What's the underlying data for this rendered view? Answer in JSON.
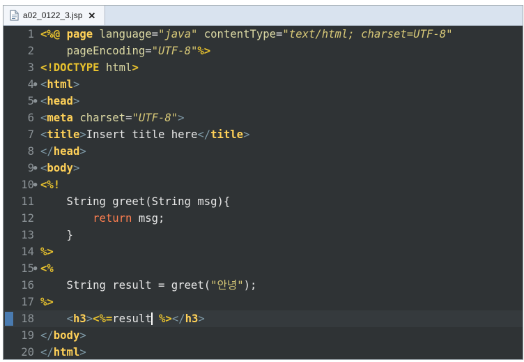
{
  "tab": {
    "filename": "a02_0122_3.jsp",
    "close_glyph": "✕"
  },
  "lines": [
    {
      "n": "1",
      "fold": "",
      "tokens": [
        [
          "jsp",
          "<%@ "
        ],
        [
          "tn",
          "page "
        ],
        [
          "att",
          "language"
        ],
        [
          "plain",
          "="
        ],
        [
          "val",
          "\"java\""
        ],
        [
          "plain",
          " "
        ],
        [
          "att",
          "contentType"
        ],
        [
          "plain",
          "="
        ],
        [
          "val",
          "\"text/html; charset=UTF-8\""
        ]
      ]
    },
    {
      "n": "2",
      "fold": "",
      "tokens": [
        [
          "plain",
          "    "
        ],
        [
          "att",
          "pageEncoding"
        ],
        [
          "plain",
          "="
        ],
        [
          "val",
          "\"UTF-8\""
        ],
        [
          "jsp",
          "%>"
        ]
      ]
    },
    {
      "n": "3",
      "fold": "",
      "tokens": [
        [
          "jsp",
          "<!DOCTYPE "
        ],
        [
          "att",
          "html"
        ],
        [
          "jsp",
          ">"
        ]
      ]
    },
    {
      "n": "4",
      "fold": "●",
      "tokens": [
        [
          "tag",
          "<"
        ],
        [
          "tn",
          "html"
        ],
        [
          "tag",
          ">"
        ]
      ]
    },
    {
      "n": "5",
      "fold": "●",
      "tokens": [
        [
          "tag",
          "<"
        ],
        [
          "tn",
          "head"
        ],
        [
          "tag",
          ">"
        ]
      ]
    },
    {
      "n": "6",
      "fold": "",
      "tokens": [
        [
          "tag",
          "<"
        ],
        [
          "tn",
          "meta "
        ],
        [
          "att",
          "charset"
        ],
        [
          "plain",
          "="
        ],
        [
          "val",
          "\"UTF-8\""
        ],
        [
          "tag",
          ">"
        ]
      ]
    },
    {
      "n": "7",
      "fold": "",
      "tokens": [
        [
          "tag",
          "<"
        ],
        [
          "tn",
          "title"
        ],
        [
          "tag",
          ">"
        ],
        [
          "plain",
          "Insert title here"
        ],
        [
          "tag",
          "</"
        ],
        [
          "tn",
          "title"
        ],
        [
          "tag",
          ">"
        ]
      ]
    },
    {
      "n": "8",
      "fold": "",
      "tokens": [
        [
          "tag",
          "</"
        ],
        [
          "tn",
          "head"
        ],
        [
          "tag",
          ">"
        ]
      ]
    },
    {
      "n": "9",
      "fold": "●",
      "tokens": [
        [
          "tag",
          "<"
        ],
        [
          "tn",
          "body"
        ],
        [
          "tag",
          ">"
        ]
      ]
    },
    {
      "n": "10",
      "fold": "●",
      "tokens": [
        [
          "jsp",
          "<%!"
        ]
      ]
    },
    {
      "n": "11",
      "fold": "",
      "tokens": [
        [
          "plain",
          "    String greet(String msg){"
        ]
      ]
    },
    {
      "n": "12",
      "fold": "",
      "tokens": [
        [
          "plain",
          "        "
        ],
        [
          "kw",
          "return"
        ],
        [
          "plain",
          " msg;"
        ]
      ]
    },
    {
      "n": "13",
      "fold": "",
      "tokens": [
        [
          "plain",
          "    }"
        ]
      ]
    },
    {
      "n": "14",
      "fold": "",
      "tokens": [
        [
          "jsp",
          "%>"
        ]
      ]
    },
    {
      "n": "15",
      "fold": "●",
      "tokens": [
        [
          "jsp",
          "<%"
        ]
      ]
    },
    {
      "n": "16",
      "fold": "",
      "tokens": [
        [
          "plain",
          "    String result = greet("
        ],
        [
          "str",
          "\"안녕\""
        ],
        [
          "plain",
          ");"
        ]
      ]
    },
    {
      "n": "17",
      "fold": "",
      "tokens": [
        [
          "jsp",
          "%>"
        ]
      ]
    },
    {
      "n": "18",
      "fold": "",
      "current": true,
      "tokens": [
        [
          "plain",
          "    "
        ],
        [
          "tag",
          "<"
        ],
        [
          "tn",
          "h3"
        ],
        [
          "tag",
          ">"
        ],
        [
          "jsp",
          "<%="
        ],
        [
          "plain",
          "result"
        ],
        [
          "caret",
          ""
        ],
        [
          "plain",
          " "
        ],
        [
          "jsp",
          "%>"
        ],
        [
          "tag",
          "</"
        ],
        [
          "tn",
          "h3"
        ],
        [
          "tag",
          ">"
        ]
      ]
    },
    {
      "n": "19",
      "fold": "",
      "tokens": [
        [
          "tag",
          "</"
        ],
        [
          "tn",
          "body"
        ],
        [
          "tag",
          ">"
        ]
      ]
    },
    {
      "n": "20",
      "fold": "",
      "tokens": [
        [
          "tag",
          "</"
        ],
        [
          "tn",
          "html"
        ],
        [
          "tag",
          ">"
        ]
      ]
    }
  ]
}
